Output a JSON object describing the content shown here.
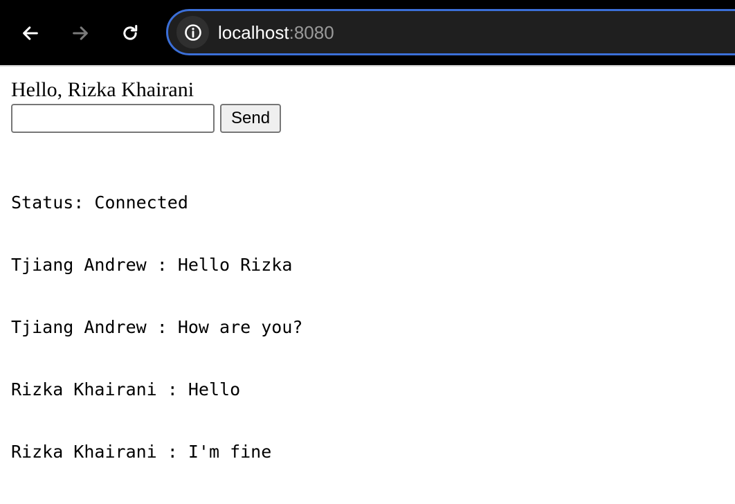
{
  "browser": {
    "url_host": "localhost",
    "url_port": ":8080",
    "icons": {
      "back": "arrow-left-icon",
      "forward": "arrow-right-icon",
      "reload": "reload-icon",
      "site_info": "info-icon"
    }
  },
  "page": {
    "greeting": "Hello, Rizka Khairani",
    "message_input": {
      "value": "",
      "placeholder": ""
    },
    "send_label": "Send",
    "status": "Status: Connected",
    "messages": [
      "Tjiang Andrew : Hello Rizka",
      "Tjiang Andrew : How are you?",
      "Rizka Khairani : Hello",
      "Rizka Khairani : I'm fine"
    ]
  },
  "colors": {
    "toolbar_bg": "#000000",
    "url_border": "#3b6fd8",
    "url_bg": "#1f1f1f",
    "url_port_text": "#9a9a9a"
  }
}
